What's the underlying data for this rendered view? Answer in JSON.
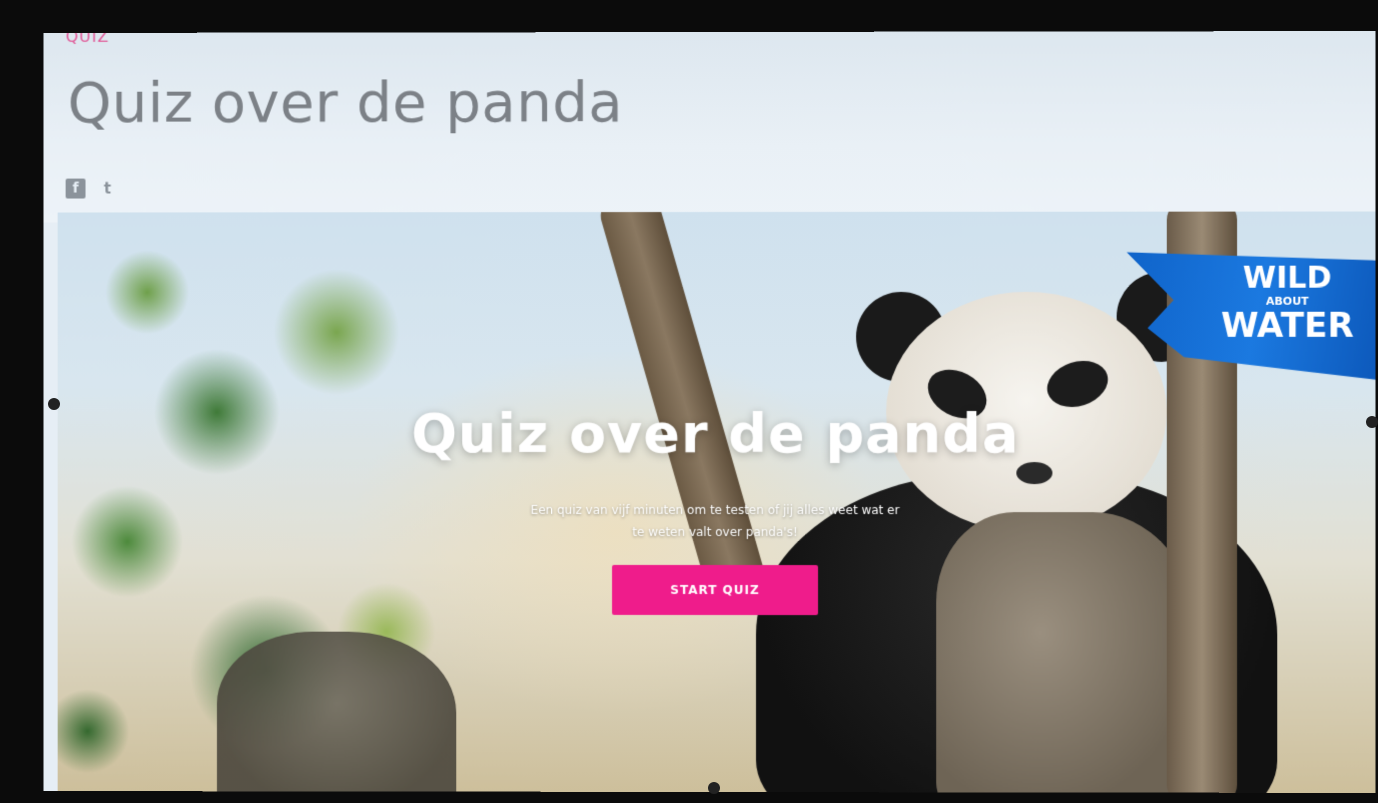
{
  "header": {
    "kicker": "QUIZ",
    "title": "Quiz over de panda"
  },
  "social": {
    "facebook": "f",
    "twitter": "t",
    "facebook_icon": "facebook-icon",
    "twitter_icon": "twitter-icon"
  },
  "hero": {
    "title": "Quiz over de panda",
    "subtitle": "Een quiz van vijf minuten om te testen of jij alles weet wat er te weten valt over panda's!",
    "button_label": "START QUIZ"
  },
  "brand": {
    "line1": "WILD",
    "line2": "ABOUT",
    "line3": "WATER"
  },
  "colors": {
    "accent": "#ef1c8b",
    "brand_blue": "#1b79e0",
    "title_gray": "#7c8187"
  }
}
